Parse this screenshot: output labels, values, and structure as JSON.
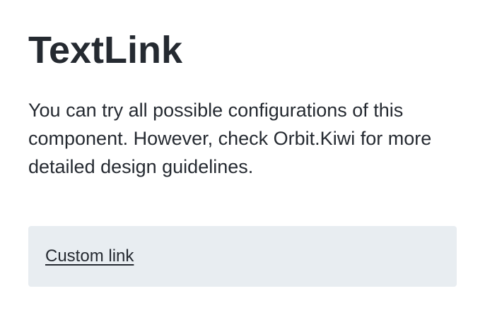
{
  "page": {
    "title": "TextLink",
    "description": "You can try all possible configurations of this component. However, check Orbit.Kiwi for more detailed design guidelines."
  },
  "example": {
    "link_label": "Custom link"
  },
  "colors": {
    "text": "#252a31",
    "example_background": "#e8edf1",
    "page_background": "#ffffff"
  }
}
